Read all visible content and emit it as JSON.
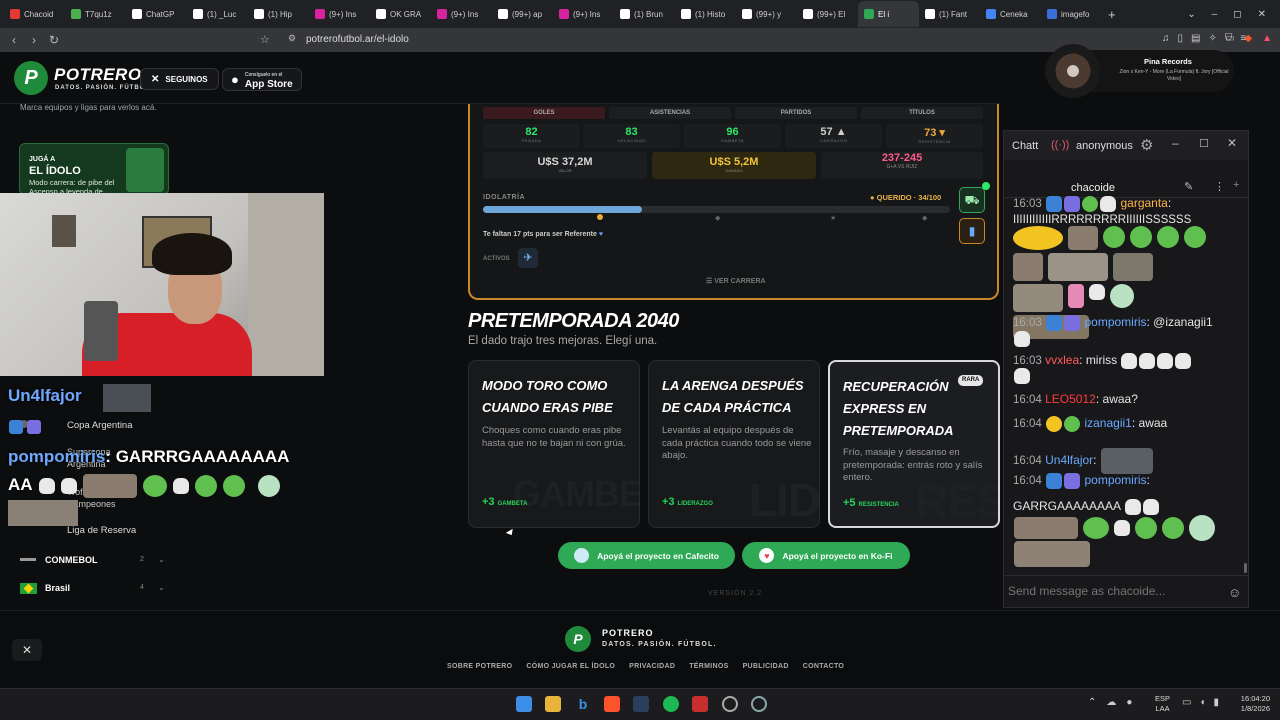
{
  "browser": {
    "tabs": [
      {
        "label": "Chacoid",
        "color": "#e53935"
      },
      {
        "label": "T7qu1z",
        "color": "#4caf50"
      },
      {
        "label": "ChatGP",
        "color": "#ffffff"
      },
      {
        "label": "(1) _Luc",
        "color": "#ffffff"
      },
      {
        "label": "(1) Hip",
        "color": "#ffffff"
      },
      {
        "label": "(9+) Ins",
        "color": "#d6249f"
      },
      {
        "label": "OK GRA",
        "color": "#ffffff"
      },
      {
        "label": "(9+) Ins",
        "color": "#d6249f"
      },
      {
        "label": "(99+) ap",
        "color": "#ffffff"
      },
      {
        "label": "(9+) Ins",
        "color": "#d6249f"
      },
      {
        "label": "(1) Brun",
        "color": "#ffffff"
      },
      {
        "label": "(1) Histo",
        "color": "#ffffff"
      },
      {
        "label": "(99+) y",
        "color": "#ffffff"
      },
      {
        "label": "(99+) El",
        "color": "#ffffff"
      },
      {
        "label": "El i",
        "color": "#2fa956"
      },
      {
        "label": "(1) Fant",
        "color": "#ffffff"
      },
      {
        "label": "Ceneka",
        "color": "#4285f4"
      },
      {
        "label": "imagefo",
        "color": "#3a6fd8"
      }
    ],
    "url": "potrerofutbol.ar/el-idolo"
  },
  "site": {
    "brand": "POTRERO",
    "tagline": "DATOS. PASIÓN. FÚTBOL.",
    "follow_label": "SEGUINOS",
    "appstore_small": "Consíguelo en el",
    "appstore_big": "App Store",
    "sidebar": {
      "hint": "Marca equipos y ligas para verlos acá.",
      "promo_small": "JUGÁ A",
      "promo_title": "EL ÍDOLO",
      "promo_desc": "Modo carrera: de pibe del Ascenso a leyenda de",
      "items": [
        {
          "label": "Copa Argentina"
        },
        {
          "label": "Supercopa Argentina"
        },
        {
          "label": "Trofeo de Campeones"
        },
        {
          "label": "Liga de Reserva"
        }
      ],
      "groups": [
        {
          "label": "CONMEBOL",
          "count": "2"
        },
        {
          "label": "Brasil",
          "count": "4"
        }
      ]
    },
    "stats_headers": [
      "GOLES",
      "ASISTENCIAS",
      "PARTIDOS",
      "TÍTULOS"
    ],
    "stats": [
      {
        "value": "82",
        "label": "PEGADA",
        "color": "#2ee86a"
      },
      {
        "value": "83",
        "label": "VELOCIDAD",
        "color": "#2ee86a"
      },
      {
        "value": "96",
        "label": "GAMBETA",
        "color": "#2ee86a"
      },
      {
        "value": "57 ▲",
        "label": "LIDERAZGO",
        "color": "#cfcfcf"
      },
      {
        "value": "73 ▾",
        "label": "RESISTENCIA",
        "color": "#e8a93b"
      }
    ],
    "money": [
      {
        "value": "U$S 37,2M",
        "label": "VALOR",
        "color": "#cfcfcf"
      },
      {
        "value": "U$S 5,2M",
        "label": "GANADO",
        "color": "#f0c43b"
      },
      {
        "value": "237-245",
        "label": "G+A VS RUIZ",
        "color": "#ff5a8a"
      }
    ],
    "idolatria": {
      "label": "IDOLATRÍA",
      "status": "QUERIDO · 34/100",
      "progress": 0.34,
      "note": "Te faltan 17 pts para ser Referente"
    },
    "activos_label": "ACTIVOS",
    "career_link": "VER CARRERA",
    "preseason": {
      "title": "PRETEMPORADA 2040",
      "subtitle": "El dado trajo tres mejoras. Elegí una.",
      "cards": [
        {
          "title": "MODO TORO COMO CUANDO ERAS PIBE",
          "desc": "Choques como cuando eras pibe hasta que no te bajan ni con grúa.",
          "bonus": "+3",
          "stat": "GAMBETA",
          "watermark": "GAMBETA",
          "tag": ""
        },
        {
          "title": "LA ARENGA DESPUÉS DE CADA PRÁCTICA",
          "desc": "Levantás al equipo después de cada práctica cuando todo se viene abajo.",
          "bonus": "+3",
          "stat": "LIDERAZGO",
          "watermark": "LID",
          "tag": ""
        },
        {
          "title": "RECUPERACIÓN EXPRESS EN PRETEMPORADA",
          "desc": "Frío, masaje y descanso en pretemporada: entrás roto y salís entero.",
          "bonus": "+5",
          "stat": "RESISTENCIA",
          "watermark": "RES",
          "tag": "RARA"
        }
      ]
    },
    "donate": [
      {
        "label": "Apoyá el proyecto en Cafecito"
      },
      {
        "label": "Apoyá el proyecto en Ko-Fi"
      }
    ],
    "version": "VERSIÓN 2.2",
    "footer": {
      "brand": "POTRERO",
      "tagline": "DATOS. PASIÓN. FÚTBOL.",
      "links": [
        "SOBRE POTRERO",
        "CÓMO JUGAR EL ÍDOLO",
        "PRIVACIDAD",
        "TÉRMINOS",
        "PUBLICIDAD",
        "CONTACTO"
      ]
    }
  },
  "spotify": {
    "title": "Pina Records",
    "subtitle": "Zion x Ken-Y - More (La Formula) ft. Jory [Official Video]"
  },
  "chat": {
    "window_title": "Chatt",
    "user": "anonymous",
    "channel": "chacoide",
    "placeholder": "Send message as chacoide...",
    "messages": [
      {
        "time": "16:03",
        "user": "garganta",
        "color": "#ffb347",
        "text": "IIIIIIIIIIIIRRRRRRRRRIIIIIISSSSSS"
      },
      {
        "time": "16:03",
        "user": "pompomiris",
        "color": "#6aa9ff",
        "text": "@izanagii1"
      },
      {
        "time": "16:03",
        "user": "vvxlea",
        "color": "#ff5a5a",
        "text": "miriss"
      },
      {
        "time": "16:04",
        "user": "LEO5012",
        "color": "#ff3b3b",
        "text": "awaa?"
      },
      {
        "time": "16:04",
        "user": "izanagii1",
        "color": "#6aa9ff",
        "text": "awaa"
      },
      {
        "time": "16:04",
        "user": "Un4lfajor",
        "color": "#6aa9ff",
        "text": ""
      },
      {
        "time": "16:04",
        "user": "pompomiris",
        "color": "#6aa9ff",
        "text": "GARRGAAAAAAAA"
      }
    ]
  },
  "overlay": {
    "line1_user": "Un4lfajor",
    "line2_user": "pompomiris",
    "line2_text": "GARRRGAAAAAAAA",
    "line2_cont": "AA"
  },
  "taskbar": {
    "lang": "ESP",
    "region": "LAA",
    "time": "16:04:20",
    "date": "1/8/2026"
  }
}
